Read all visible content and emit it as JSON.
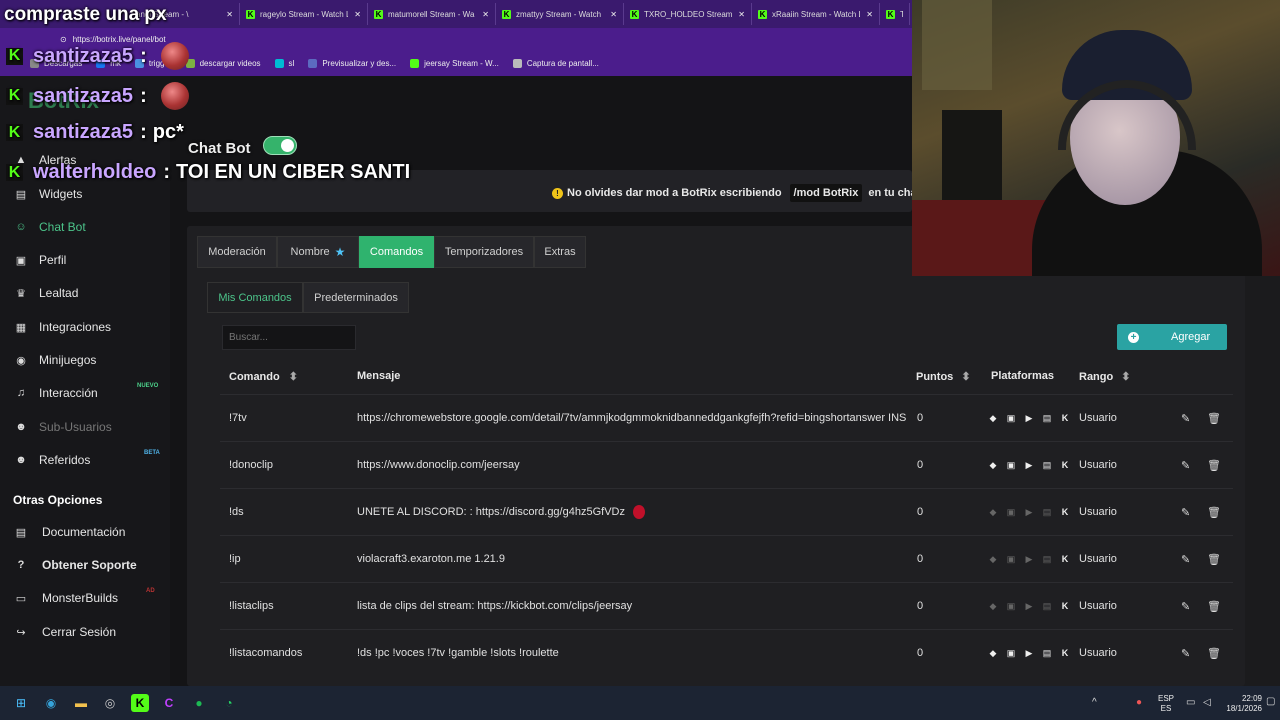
{
  "overlay_title": "compraste una px",
  "browser": {
    "tabs": [
      {
        "label": "andi Stream - \\"
      },
      {
        "label": "rageylo Stream - Watch L"
      },
      {
        "label": "matumorell Stream - Wa"
      },
      {
        "label": "zmattyy Stream - Watch"
      },
      {
        "label": "TXRO_HOLDEO Stream -"
      },
      {
        "label": "xRaaiin Stream - Watch L"
      },
      {
        "label": "T"
      }
    ],
    "url": "https://botrix.live/panel/bot",
    "bookmarks": [
      {
        "label": "Descargas",
        "color": "#888"
      },
      {
        "label": "mk",
        "color": "#1877f2"
      },
      {
        "label": "trigger",
        "color": "#4a90e2"
      },
      {
        "label": "descargar videos",
        "color": "#7cb342"
      },
      {
        "label": "sl",
        "color": "#00bcd4"
      },
      {
        "label": "Previsualizar y des...",
        "color": "#5c6bc0"
      },
      {
        "label": "jeersay Stream - W...",
        "color": "#53fc18"
      },
      {
        "label": "Captura de pantall...",
        "color": "#bbb"
      }
    ]
  },
  "chat": [
    {
      "user": "santizaza5",
      "sep": ":",
      "msg": "",
      "emote": true
    },
    {
      "user": "santizaza5",
      "sep": ":",
      "msg": "",
      "emote": true
    },
    {
      "user": "santizaza5",
      "sep": ":",
      "msg": "pc*",
      "emote": false
    },
    {
      "user": "walterholdeo",
      "sep": ":",
      "msg": "TOI EN UN CIBER SANTI",
      "emote": false
    }
  ],
  "brand": "BotRix",
  "chatbot_label": "Chat Bot",
  "chatbot_enabled": true,
  "sidebar": {
    "items": [
      {
        "label": "Alertas",
        "icon": "alert-icon"
      },
      {
        "label": "Widgets",
        "icon": "widgets-icon"
      },
      {
        "label": "Chat Bot",
        "icon": "robot-icon",
        "active": true
      },
      {
        "label": "Perfil",
        "icon": "profile-icon"
      },
      {
        "label": "Lealtad",
        "icon": "trophy-icon"
      },
      {
        "label": "Integraciones",
        "icon": "integrations-icon"
      },
      {
        "label": "Minijuegos",
        "icon": "gamepad-icon"
      },
      {
        "label": "Interacción",
        "icon": "music-icon",
        "badge": "NUEVO"
      },
      {
        "label": "Sub-Usuarios",
        "icon": "subusers-icon",
        "dim": true
      },
      {
        "label": "Referidos",
        "icon": "referrals-icon",
        "badge": "BETA"
      }
    ],
    "other_heading": "Otras Opciones",
    "other_items": [
      {
        "label": "Documentación",
        "icon": "docs-icon"
      },
      {
        "label": "Obtener Soporte",
        "icon": "help-icon"
      },
      {
        "label": "MonsterBuilds",
        "icon": "monitor-icon",
        "badge": "AD"
      },
      {
        "label": "Cerrar Sesión",
        "icon": "logout-icon"
      }
    ]
  },
  "notice": {
    "text": "No olvides dar mod a BotRix escribiendo",
    "command": "/mod BotRix",
    "suffix": "en tu chat."
  },
  "tabs": [
    "Moderación",
    "Nombre",
    "Comandos",
    "Temporizadores",
    "Extras"
  ],
  "active_tab": "Comandos",
  "subtabs": [
    "Mis Comandos",
    "Predeterminados"
  ],
  "search_placeholder": "Buscar...",
  "add_button": "Agregar",
  "table": {
    "headers": [
      "Comando",
      "Mensaje",
      "Puntos",
      "Plataformas",
      "Rango"
    ],
    "rows": [
      {
        "command": "!7tv",
        "message": "https://chromewebstore.google.com/detail/7tv/ammjkodgmmoknidbanneddgankgfejfh?refid=bingshortanswer INS",
        "points": "0",
        "platforms_on": true,
        "rank": "Usuario"
      },
      {
        "command": "!donoclip",
        "message": "https://www.donoclip.com/jeersay",
        "points": "0",
        "platforms_on": true,
        "rank": "Usuario"
      },
      {
        "command": "!ds",
        "message": "UNETE AL DISCORD: : https://discord.gg/g4hz5GfVDz",
        "points": "0",
        "platforms_on": false,
        "rank": "Usuario"
      },
      {
        "command": "!ip",
        "message": "violacraft3.exaroton.me 1.21.9",
        "points": "0",
        "platforms_on": false,
        "rank": "Usuario"
      },
      {
        "command": "!listaclips",
        "message": "lista de clips del stream: https://kickbot.com/clips/jeersay",
        "points": "0",
        "platforms_on": false,
        "rank": "Usuario"
      },
      {
        "command": "!listacomandos",
        "message": "!ds !pc !voces !7tv !gamble !slots !roulette",
        "points": "0",
        "platforms_on": true,
        "rank": "Usuario"
      }
    ]
  },
  "taskbar": {
    "lang": "ESP",
    "lang2": "ES",
    "time": "22:09",
    "date": "18/1/2026"
  }
}
